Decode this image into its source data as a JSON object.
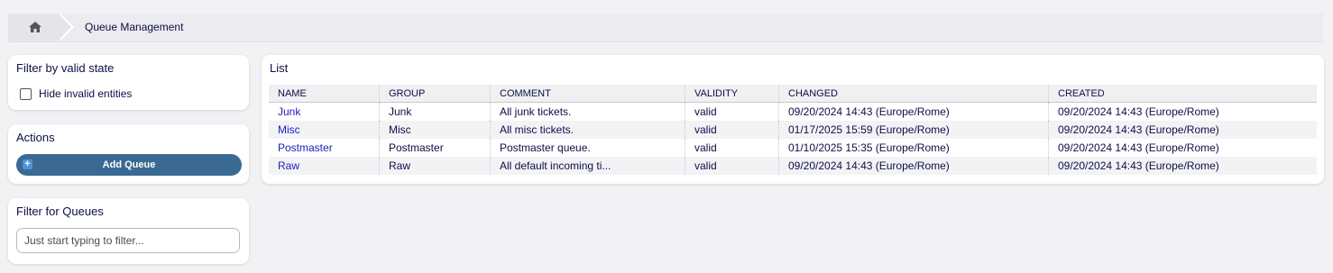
{
  "breadcrumb": {
    "home_icon": "home-icon",
    "current": "Queue Management"
  },
  "sidebar": {
    "filter_valid": {
      "title": "Filter by valid state",
      "checkbox_label": "Hide invalid entities",
      "checked": false
    },
    "actions": {
      "title": "Actions",
      "add_label": "Add Queue",
      "add_icon": "plus-square-icon"
    },
    "filter_queues": {
      "title": "Filter for Queues",
      "placeholder": "Just start typing to filter..."
    }
  },
  "list": {
    "title": "List",
    "columns": [
      "NAME",
      "GROUP",
      "COMMENT",
      "VALIDITY",
      "CHANGED",
      "CREATED"
    ],
    "rows": [
      {
        "name": "Junk",
        "group": "Junk",
        "comment": "All junk tickets.",
        "validity": "valid",
        "changed": "09/20/2024 14:43 (Europe/Rome)",
        "created": "09/20/2024 14:43 (Europe/Rome)"
      },
      {
        "name": "Misc",
        "group": "Misc",
        "comment": "All misc tickets.",
        "validity": "valid",
        "changed": "01/17/2025 15:59 (Europe/Rome)",
        "created": "09/20/2024 14:43 (Europe/Rome)"
      },
      {
        "name": "Postmaster",
        "group": "Postmaster",
        "comment": "Postmaster queue.",
        "validity": "valid",
        "changed": "01/10/2025 15:35 (Europe/Rome)",
        "created": "09/20/2024 14:43 (Europe/Rome)"
      },
      {
        "name": "Raw",
        "group": "Raw",
        "comment": "All default incoming ti...",
        "validity": "valid",
        "changed": "09/20/2024 14:43 (Europe/Rome)",
        "created": "09/20/2024 14:43 (Europe/Rome)"
      }
    ]
  },
  "colors": {
    "background": "#f2f2f5",
    "text": "#0b0f45",
    "link": "#2020b8",
    "button": "#3a6a93"
  }
}
